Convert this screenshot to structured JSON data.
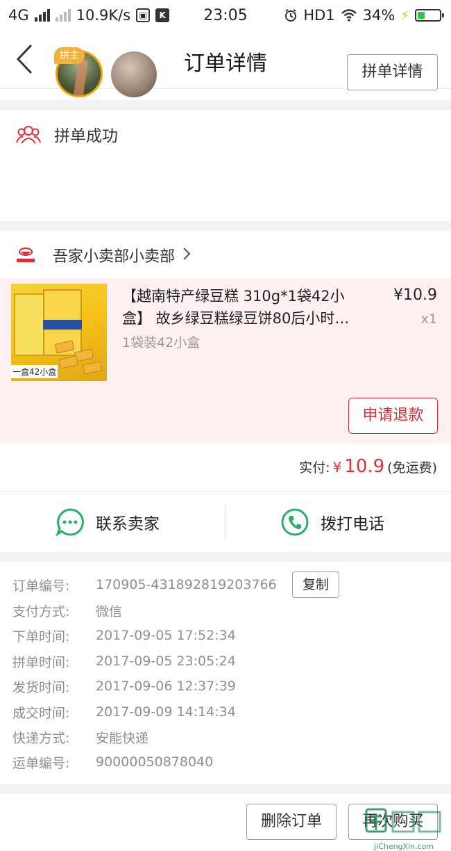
{
  "status_bar": {
    "network": "4G",
    "speed": "10.9K/s",
    "time": "23:05",
    "hd_label": "HD1",
    "battery": "34%",
    "battery_level": 0.34
  },
  "nav": {
    "title": "订单详情"
  },
  "group": {
    "title": "拼单成功",
    "host_tag": "拼主",
    "detail_button": "拼单详情"
  },
  "shop": {
    "name": "吾家小卖部小卖部"
  },
  "product": {
    "title": "【越南特产绿豆糕 310g*1袋42小盒】 故乡绿豆糕绿豆饼80后小时…",
    "spec": "1袋装42小盒",
    "price": "¥10.9",
    "qty": "x1",
    "image_caption": "一盒42小盒",
    "refund_button": "申请退款"
  },
  "payment": {
    "label": "实付:",
    "currency": "¥",
    "amount": "10.9",
    "note": "(免运费)"
  },
  "contact": {
    "seller": "联系卖家",
    "phone": "拨打电话"
  },
  "details": {
    "copy_button": "复制",
    "rows": [
      {
        "label": "订单编号:",
        "value": "170905-431892819203766"
      },
      {
        "label": "支付方式:",
        "value": "微信"
      },
      {
        "label": "下单时间:",
        "value": "2017-09-05 17:52:34"
      },
      {
        "label": "拼单时间:",
        "value": "2017-09-05 23:05:24"
      },
      {
        "label": "发货时间:",
        "value": "2017-09-06 12:37:39"
      },
      {
        "label": "成交时间:",
        "value": "2017-09-09 14:14:34"
      },
      {
        "label": "快递方式:",
        "value": "安能快递"
      },
      {
        "label": "运单编号:",
        "value": "90000050878040"
      }
    ]
  },
  "bottom": {
    "delete_button": "删除订单",
    "rebuy_button": "再次购买"
  },
  "watermark": {
    "text": "JiChengXin.com"
  },
  "colors": {
    "accent": "#e0303b",
    "wechat_green": "#2aae67",
    "host_gold": "#f2b13d"
  }
}
